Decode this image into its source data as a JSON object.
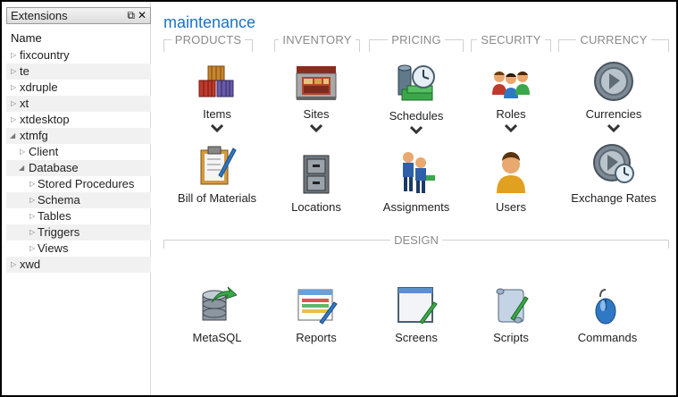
{
  "panel": {
    "title": "Extensions",
    "float_icon": "⧉",
    "close_icon": "✕",
    "column_header": "Name",
    "items": [
      {
        "label": "fixcountry",
        "expanded": false,
        "level": 0
      },
      {
        "label": "te",
        "expanded": false,
        "level": 0
      },
      {
        "label": "xdruple",
        "expanded": false,
        "level": 0
      },
      {
        "label": "xt",
        "expanded": false,
        "level": 0
      },
      {
        "label": "xtdesktop",
        "expanded": false,
        "level": 0
      },
      {
        "label": "xtmfg",
        "expanded": true,
        "level": 0
      },
      {
        "label": "Client",
        "expanded": false,
        "level": 1
      },
      {
        "label": "Database",
        "expanded": true,
        "level": 1
      },
      {
        "label": "Stored Procedures",
        "expanded": false,
        "level": 2
      },
      {
        "label": "Schema",
        "expanded": false,
        "level": 2
      },
      {
        "label": "Tables",
        "expanded": false,
        "level": 2
      },
      {
        "label": "Triggers",
        "expanded": false,
        "level": 2
      },
      {
        "label": "Views",
        "expanded": false,
        "level": 2
      },
      {
        "label": "xwd",
        "expanded": false,
        "level": 0
      }
    ]
  },
  "main": {
    "title": "maintenance",
    "groups": [
      {
        "label": "PRODUCTS",
        "items": [
          {
            "label": "Items",
            "icon": "crates-icon",
            "dropdown": true
          },
          {
            "label": "Bill of Materials",
            "icon": "clipboard-icon"
          }
        ]
      },
      {
        "label": "INVENTORY",
        "items": [
          {
            "label": "Sites",
            "icon": "warehouse-icon",
            "dropdown": true
          },
          {
            "label": "Locations",
            "icon": "filing-cabinet-icon"
          }
        ]
      },
      {
        "label": "PRICING",
        "items": [
          {
            "label": "Schedules",
            "icon": "coins-clock-icon",
            "dropdown": true
          },
          {
            "label": "Assignments",
            "icon": "people-icon"
          }
        ]
      },
      {
        "label": "SECURITY",
        "items": [
          {
            "label": "Roles",
            "icon": "users-group-icon",
            "dropdown": true
          },
          {
            "label": "Users",
            "icon": "user-icon"
          }
        ]
      },
      {
        "label": "CURRENCY",
        "items": [
          {
            "label": "Currencies",
            "icon": "coin-icon",
            "dropdown": true
          },
          {
            "label": "Exchange Rates",
            "icon": "coin-clock-icon"
          }
        ]
      }
    ],
    "design": {
      "label": "DESIGN",
      "items": [
        {
          "label": "MetaSQL",
          "icon": "database-arrow-icon"
        },
        {
          "label": "Reports",
          "icon": "report-icon"
        },
        {
          "label": "Screens",
          "icon": "window-icon"
        },
        {
          "label": "Scripts",
          "icon": "scroll-icon"
        },
        {
          "label": "Commands",
          "icon": "mouse-icon"
        }
      ]
    }
  },
  "colors": {
    "title": "#1a73c8",
    "group_label": "#8a8a8a",
    "background": "#ffffff",
    "border": "#000000"
  }
}
